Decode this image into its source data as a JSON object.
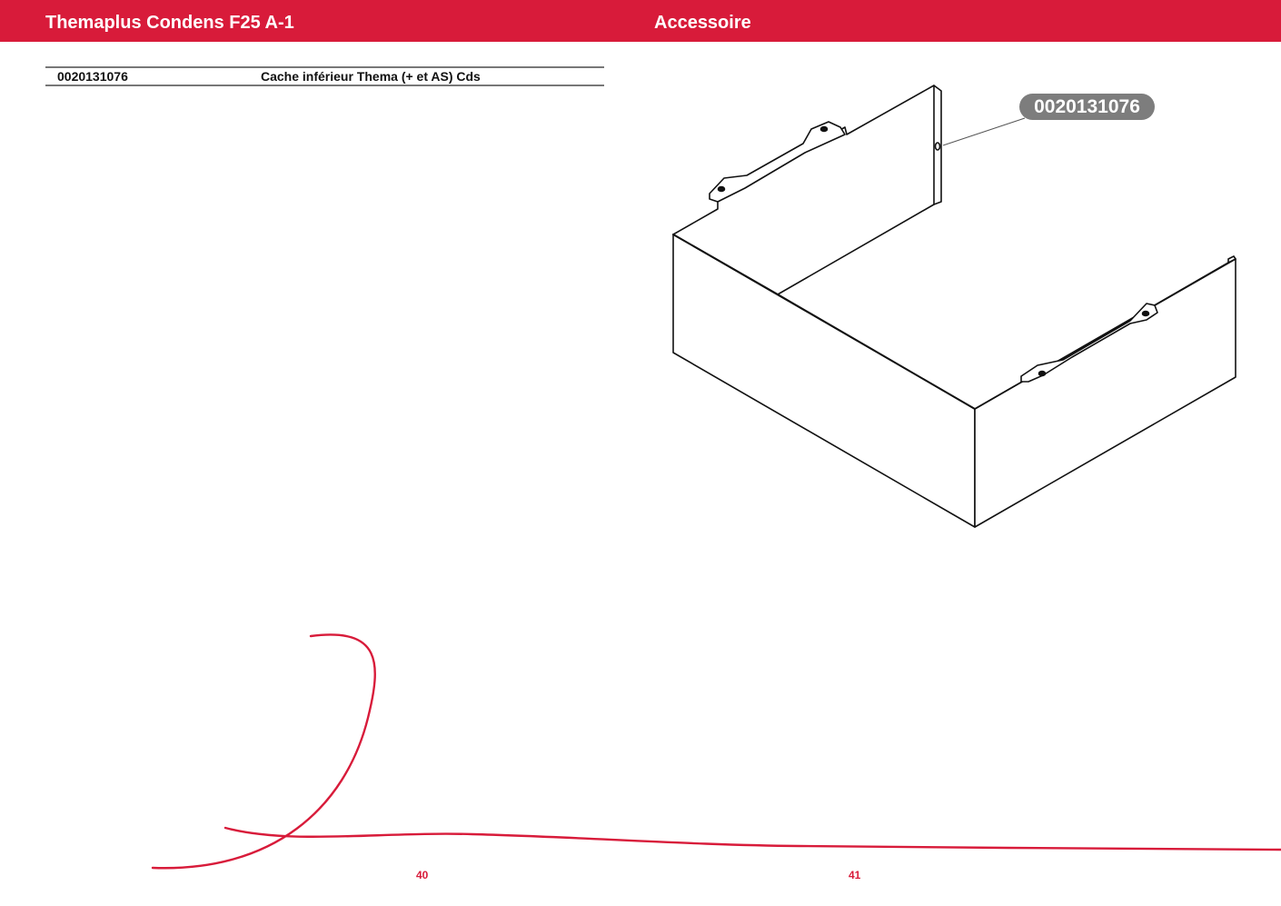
{
  "header": {
    "title_left": "Themaplus Condens F25 A-1",
    "title_right": "Accessoire",
    "background_color": "#d81b3a",
    "text_color": "#ffffff"
  },
  "parts_table": {
    "rows": [
      {
        "part_number": "0020131076",
        "description": "Cache inférieur Thema (+ et AS) Cds"
      }
    ]
  },
  "drawing": {
    "callout_label": "0020131076",
    "callout_color": "#7d7d7d"
  },
  "footer": {
    "page_left": "40",
    "page_right": "41",
    "accent_color": "#d81b3a"
  }
}
